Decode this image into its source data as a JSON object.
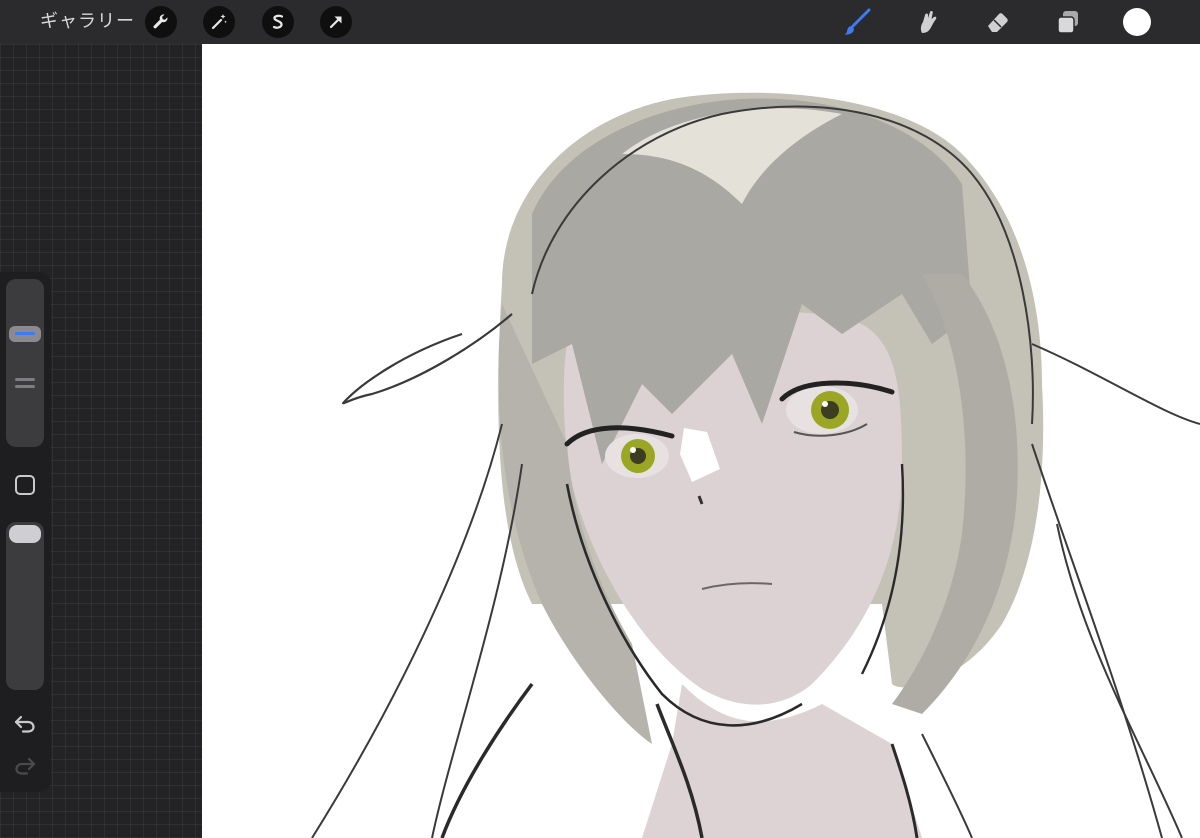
{
  "topbar": {
    "gallery_label": "ギャラリー",
    "left_tools": [
      {
        "icon": "wrench-icon"
      },
      {
        "icon": "magic-wand-icon"
      },
      {
        "icon": "selection-icon"
      },
      {
        "icon": "transform-arrow-icon"
      }
    ],
    "right_tools": [
      {
        "icon": "brush-icon",
        "active": true
      },
      {
        "icon": "smudge-icon"
      },
      {
        "icon": "eraser-icon"
      },
      {
        "icon": "layers-icon"
      }
    ],
    "current_color": "#ffffff"
  },
  "colors": {
    "accent": "#3e7bf0",
    "toolbar_bg": "#2b2b2d",
    "canvas_bg": "#ffffff"
  },
  "sidebar": {
    "size_slider_level": 0.7,
    "opacity_slider_level": 1.0,
    "modify_icon": "square-modify-icon",
    "undo_icon": "undo-icon",
    "redo_icon": "redo-icon"
  }
}
